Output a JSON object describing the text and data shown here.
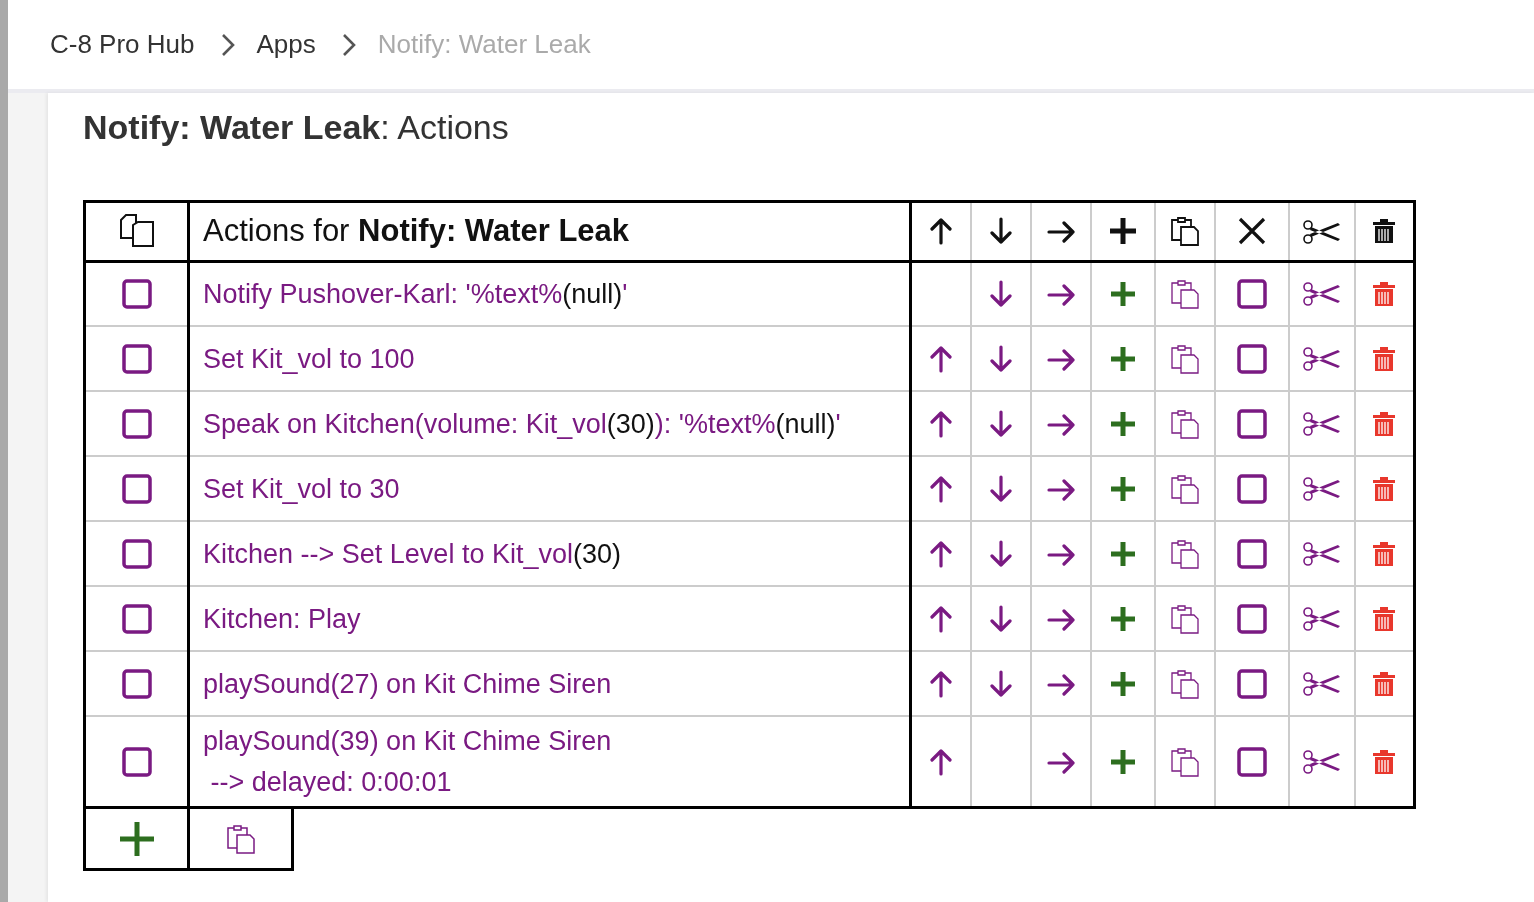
{
  "breadcrumb": [
    {
      "label": "C-8 Pro Hub",
      "current": false
    },
    {
      "label": "Apps",
      "current": false
    },
    {
      "label": "Notify: Water Leak",
      "current": true
    }
  ],
  "page_title": "**Notify: Water Leak**: Actions",
  "table": {
    "header": "Actions for **Notify: Water Leak**",
    "rows": [
      {
        "checked": false,
        "marked": false,
        "up": false,
        "down": true,
        "segments": [
          {
            "kind": "link",
            "text": "Notify Pushover-Karl: '%text%"
          },
          {
            "kind": "value",
            "text": "(null)"
          },
          {
            "kind": "link",
            "text": "'"
          }
        ]
      },
      {
        "checked": false,
        "marked": false,
        "up": true,
        "down": true,
        "segments": [
          {
            "kind": "link",
            "text": "Set Kit_vol to 100"
          }
        ]
      },
      {
        "checked": false,
        "marked": false,
        "up": true,
        "down": true,
        "segments": [
          {
            "kind": "link",
            "text": "Speak on Kitchen(volume: Kit_vol"
          },
          {
            "kind": "value",
            "text": "(30)"
          },
          {
            "kind": "link",
            "text": "): '%text%"
          },
          {
            "kind": "value",
            "text": "(null)"
          },
          {
            "kind": "link",
            "text": "'"
          }
        ]
      },
      {
        "checked": false,
        "marked": false,
        "up": true,
        "down": true,
        "segments": [
          {
            "kind": "link",
            "text": "Set Kit_vol to 30"
          }
        ]
      },
      {
        "checked": false,
        "marked": false,
        "up": true,
        "down": true,
        "segments": [
          {
            "kind": "link",
            "text": "Kitchen --> Set Level to Kit_vol"
          },
          {
            "kind": "value",
            "text": "(30)"
          }
        ]
      },
      {
        "checked": false,
        "marked": false,
        "up": true,
        "down": true,
        "segments": [
          {
            "kind": "link",
            "text": "Kitchen: Play"
          }
        ]
      },
      {
        "checked": false,
        "marked": false,
        "up": true,
        "down": true,
        "segments": [
          {
            "kind": "link",
            "text": "playSound(27) on Kit Chime Siren"
          }
        ]
      },
      {
        "checked": false,
        "marked": false,
        "up": true,
        "down": false,
        "segments": [
          {
            "kind": "link",
            "text": "playSound(39) on Kit Chime Siren"
          },
          {
            "kind": "break",
            "text": " --> delayed: 0:00:01"
          }
        ]
      }
    ]
  }
}
